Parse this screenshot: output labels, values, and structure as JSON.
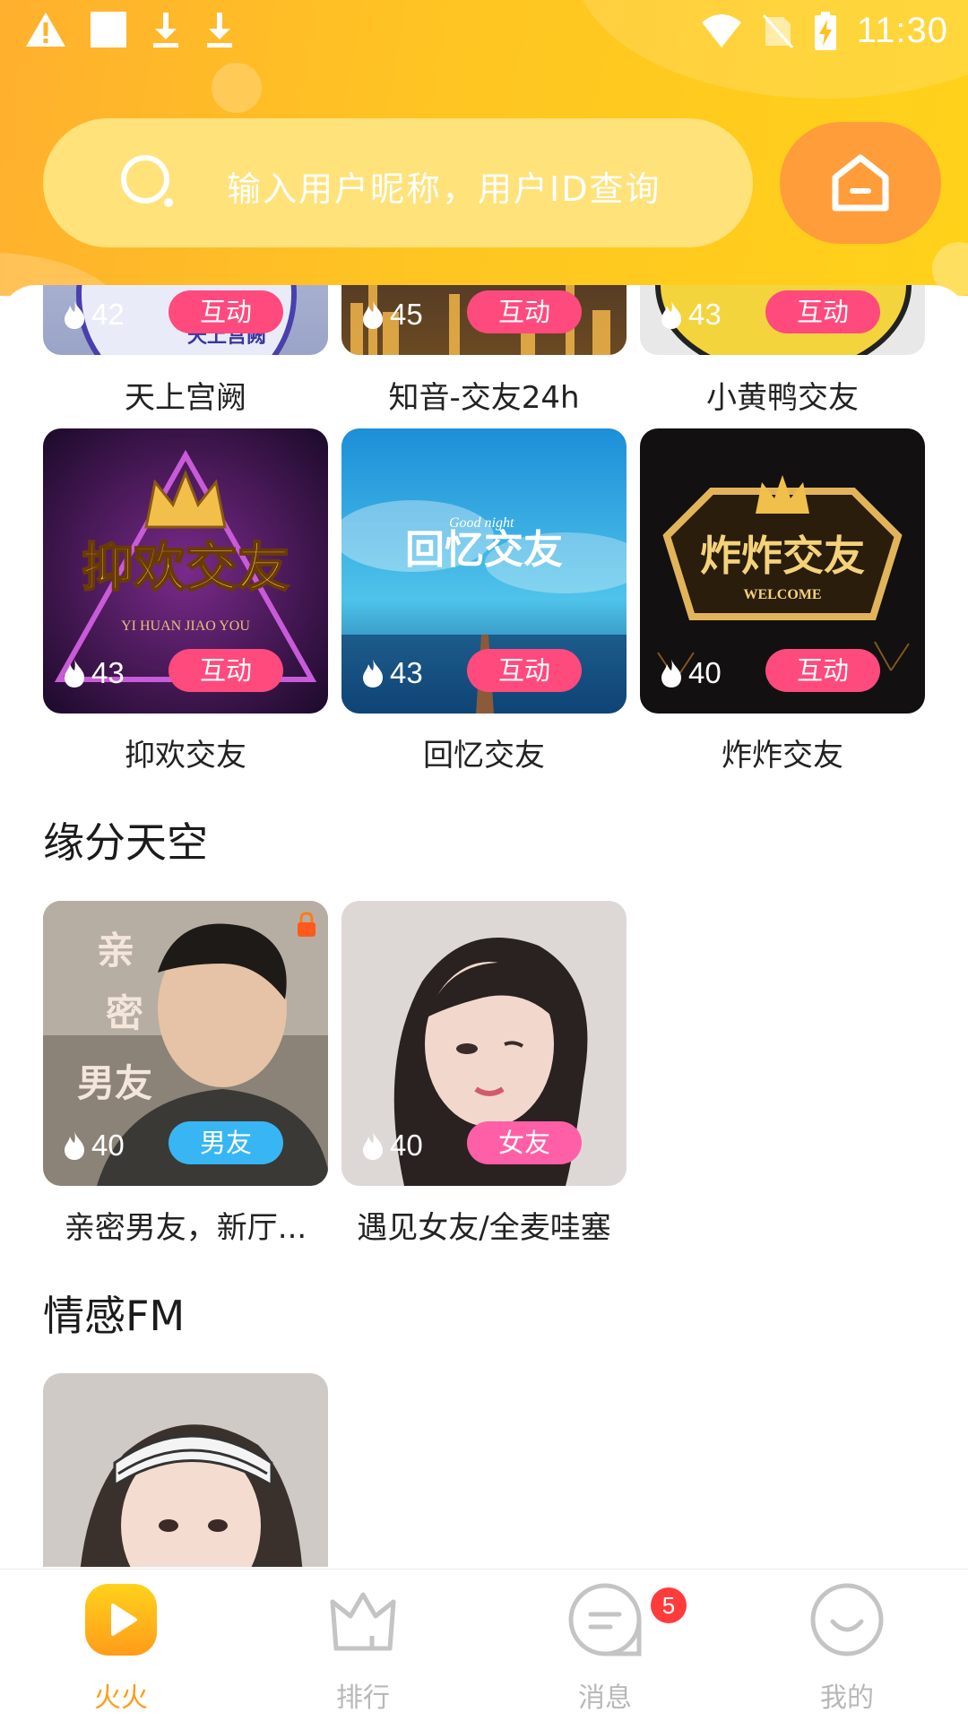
{
  "status_bar": {
    "time": "11:30",
    "left_icons": [
      "warning-icon",
      "square-icon",
      "download-icon",
      "download-icon"
    ],
    "right_icons": [
      "wifi-icon",
      "no-sim-icon",
      "battery-charging-icon"
    ]
  },
  "search": {
    "placeholder": "输入用户昵称，用户ID查询"
  },
  "colors": {
    "header_start": "#ffb02e",
    "header_end": "#ffd21a",
    "tag_pink": "#ff4a7d",
    "tag_blue": "#38b6f3",
    "tag_rose": "#ff5fa6",
    "nav_active": "#ff9c1a",
    "badge": "#ff3b3b"
  },
  "rooms_top": [
    {
      "title": "天上宫阙",
      "heat": "42",
      "tag": "互动"
    },
    {
      "title": "知音-交友24h",
      "heat": "45",
      "tag": "互动"
    },
    {
      "title": "小黄鸭交友",
      "heat": "43",
      "tag": "互动"
    },
    {
      "title": "抑欢交友",
      "heat": "43",
      "tag": "互动",
      "art_text": "抑欢交友",
      "art_sub": "YI HUAN JIAO YOU"
    },
    {
      "title": "回忆交友",
      "heat": "43",
      "tag": "互动",
      "art_text": "回忆交友",
      "art_sub": "Good night"
    },
    {
      "title": "炸炸交友",
      "heat": "40",
      "tag": "互动",
      "art_text": "炸炸交友",
      "art_sub": "WELCOME"
    }
  ],
  "section_yuanfen": {
    "title": "缘分天空",
    "rooms": [
      {
        "title": "亲密男友，新厅...",
        "heat": "40",
        "tag": "男友",
        "art_text": "亲密男友",
        "locked": true
      },
      {
        "title": "遇见女友/全麦哇塞",
        "heat": "40",
        "tag": "女友"
      }
    ]
  },
  "section_fm": {
    "title": "情感FM"
  },
  "bottom_nav": [
    {
      "label": "火火",
      "icon": "play-icon",
      "active": true
    },
    {
      "label": "排行",
      "icon": "crown-icon",
      "active": false
    },
    {
      "label": "消息",
      "icon": "message-icon",
      "active": false,
      "badge": "5"
    },
    {
      "label": "我的",
      "icon": "smile-icon",
      "active": false
    }
  ]
}
